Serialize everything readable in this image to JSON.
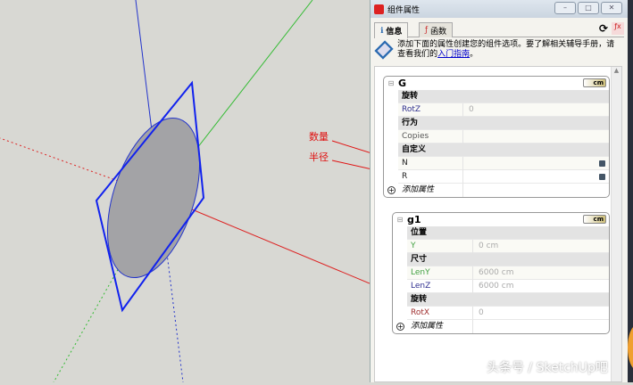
{
  "annotations": {
    "count": "数量",
    "radius": "半径"
  },
  "window": {
    "title": "组件属性",
    "min": "–",
    "max": "□",
    "close": "✕"
  },
  "tabs": [
    {
      "label": "信息"
    },
    {
      "label": "函数"
    }
  ],
  "info": {
    "text": "添加下面的属性创建您的组件选项。要了解相关辅导手册，请查看我们的",
    "link": "入门指南",
    "end": "。"
  },
  "groups": [
    {
      "name": "G",
      "unit": "cm",
      "rows": [
        {
          "type": "section",
          "label": "旋转"
        },
        {
          "type": "attr",
          "label": "RotZ",
          "value": "0",
          "color": "#303090"
        },
        {
          "type": "section",
          "label": "行为"
        },
        {
          "type": "attr",
          "label": "Copies",
          "value": "",
          "color": "#555555"
        },
        {
          "type": "section",
          "label": "自定义"
        },
        {
          "type": "attr",
          "label": "N",
          "value": "",
          "color": "#222222"
        },
        {
          "type": "attr",
          "label": "R",
          "value": "",
          "color": "#222222"
        }
      ],
      "add": "添加属性"
    },
    {
      "name": "g1",
      "unit": "cm",
      "rows": [
        {
          "type": "section",
          "label": "位置"
        },
        {
          "type": "attr",
          "label": "Y",
          "value": "0 cm",
          "color": "#40a040"
        },
        {
          "type": "section",
          "label": "尺寸"
        },
        {
          "type": "attr",
          "label": "LenY",
          "value": "6000 cm",
          "color": "#40a040"
        },
        {
          "type": "attr",
          "label": "LenZ",
          "value": "6000 cm",
          "color": "#303090"
        },
        {
          "type": "section",
          "label": "旋转"
        },
        {
          "type": "attr",
          "label": "RotX",
          "value": "0",
          "color": "#a03030"
        }
      ],
      "add": "添加属性"
    }
  ],
  "watermark": "头条号 / SketchUp吧"
}
